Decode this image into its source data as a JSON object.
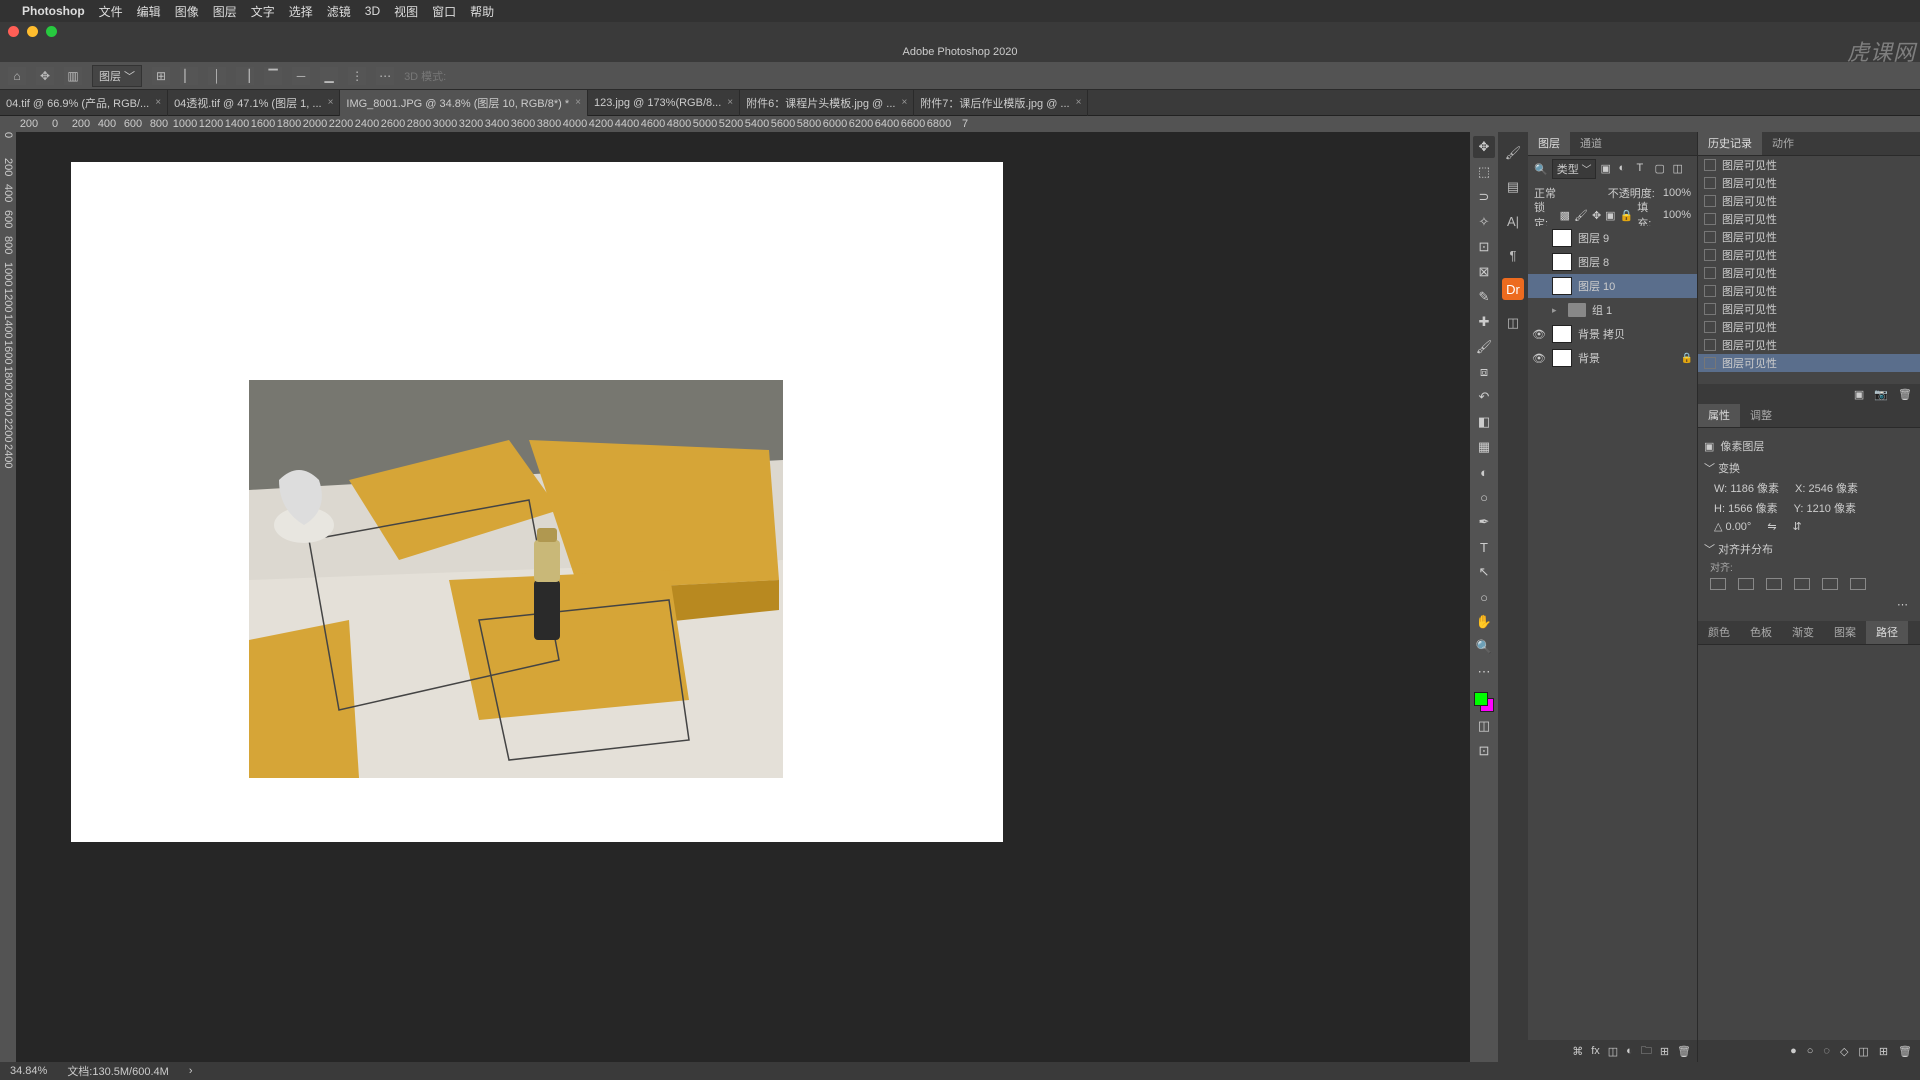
{
  "menubar": {
    "apple": "",
    "app": "Photoshop",
    "items": [
      "文件",
      "编辑",
      "图像",
      "图层",
      "文字",
      "选择",
      "滤镜",
      "3D",
      "视图",
      "窗口",
      "帮助"
    ]
  },
  "window_title": "Adobe Photoshop 2020",
  "options": {
    "layer_dd": "图层",
    "mode3d": "3D 模式:"
  },
  "tabs": [
    {
      "label": "04.tif @ 66.9% (产品, RGB/...",
      "active": false
    },
    {
      "label": "04透视.tif @ 47.1% (图层 1, ...",
      "active": false
    },
    {
      "label": "IMG_8001.JPG @ 34.8% (图层 10, RGB/8*) *",
      "active": true
    },
    {
      "label": "123.jpg @ 173%(RGB/8...",
      "active": false
    },
    {
      "label": "附件6：课程片头模板.jpg @ ...",
      "active": false
    },
    {
      "label": "附件7：课后作业模版.jpg @ ...",
      "active": false
    }
  ],
  "ruler_h": [
    "200",
    "0",
    "200",
    "400",
    "600",
    "800",
    "1000",
    "1200",
    "1400",
    "1600",
    "1800",
    "2000",
    "2200",
    "2400",
    "2600",
    "2800",
    "3000",
    "3200",
    "3400",
    "3600",
    "3800",
    "4000",
    "4200",
    "4400",
    "4600",
    "4800",
    "5000",
    "5200",
    "5400",
    "5600",
    "5800",
    "6000",
    "6200",
    "6400",
    "6600",
    "6800",
    "7"
  ],
  "ruler_v": [
    "0",
    "200",
    "400",
    "600",
    "800",
    "1000",
    "1200",
    "1400",
    "1600",
    "1800",
    "2000",
    "2200",
    "2400"
  ],
  "layers_panel": {
    "tabs": [
      "图层",
      "通道"
    ],
    "filter_label": "类型",
    "blend_mode": "正常",
    "opacity_label": "不透明度:",
    "opacity": "100%",
    "lock_label": "锁定:",
    "fill_label": "填充:",
    "fill": "100%",
    "layers": [
      {
        "vis": false,
        "name": "图层 9",
        "sel": false,
        "type": "pixel"
      },
      {
        "vis": false,
        "name": "图层 8",
        "sel": false,
        "type": "pixel"
      },
      {
        "vis": false,
        "name": "图层 10",
        "sel": true,
        "type": "pixel"
      },
      {
        "vis": false,
        "name": "组 1",
        "sel": false,
        "type": "group"
      },
      {
        "vis": true,
        "name": "背景 拷贝",
        "sel": false,
        "type": "pixel"
      },
      {
        "vis": true,
        "name": "背景",
        "sel": false,
        "type": "pixel",
        "locked": true
      }
    ]
  },
  "history_panel": {
    "tabs": [
      "历史记录",
      "动作"
    ],
    "items": [
      "图层可见性",
      "图层可见性",
      "图层可见性",
      "图层可见性",
      "图层可见性",
      "图层可见性",
      "图层可见性",
      "图层可见性",
      "图层可见性",
      "图层可见性",
      "图层可见性",
      "图层可见性"
    ]
  },
  "properties_panel": {
    "tabs": [
      "属性",
      "调整"
    ],
    "type_label": "像素图层",
    "transform_label": "变换",
    "w_label": "W:",
    "w_val": "1186 像素",
    "x_label": "X:",
    "x_val": "2546 像素",
    "h_label": "H:",
    "h_val": "1566 像素",
    "y_label": "Y:",
    "y_val": "1210 像素",
    "angle": "0.00°",
    "align_label": "对齐并分布",
    "align_sub": "对齐:"
  },
  "paths_panel": {
    "tabs": [
      "颜色",
      "色板",
      "渐变",
      "图案",
      "路径"
    ]
  },
  "status": {
    "zoom": "34.84%",
    "doc": "文档:130.5M/600.4M"
  },
  "watermark": "虎课网"
}
